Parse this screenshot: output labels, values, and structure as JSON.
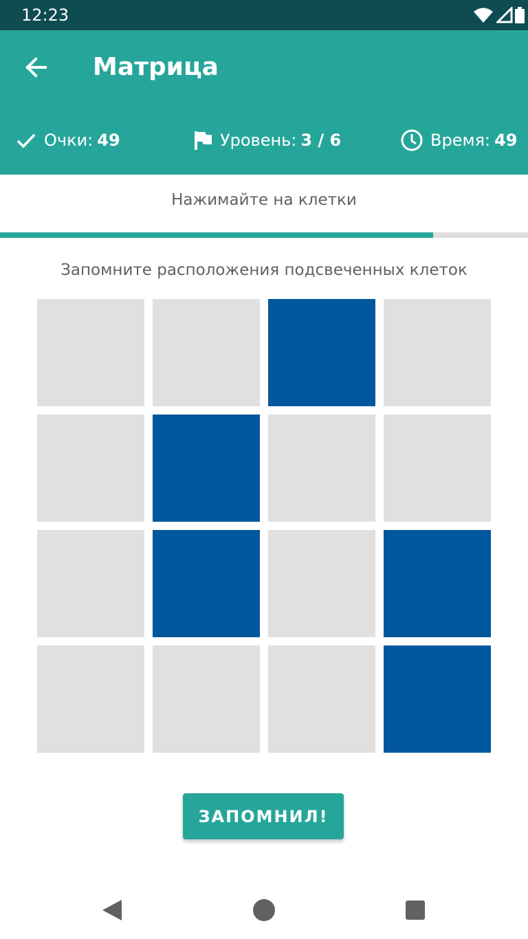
{
  "status_bar": {
    "time": "12:23",
    "icons": [
      "wifi-icon",
      "signal-icon",
      "battery-icon"
    ]
  },
  "app_bar": {
    "title": "Матрица",
    "back_icon": "arrow-back-icon",
    "color": "#26a69a"
  },
  "stats": {
    "score": {
      "icon": "check-icon",
      "label": "Очки:",
      "value": "49"
    },
    "level": {
      "icon": "flag-icon",
      "label": "Уровень:",
      "value": "3 / 6"
    },
    "time": {
      "icon": "clock-icon",
      "label": "Время:",
      "value": "49"
    }
  },
  "hint": "Нажимайте на клетки",
  "progress": {
    "fraction": 0.82
  },
  "instruction": "Запомните расположения подсвеченных клеток",
  "grid": {
    "rows": 4,
    "cols": 4,
    "active_color": "#01579b",
    "inactive_color": "#e0e0e0",
    "cells": [
      [
        false,
        false,
        true,
        false
      ],
      [
        false,
        true,
        false,
        false
      ],
      [
        false,
        true,
        false,
        true
      ],
      [
        false,
        false,
        false,
        true
      ]
    ]
  },
  "button": {
    "label": "ЗАПОМНИЛ!"
  },
  "nav": [
    "back-triangle-icon",
    "home-circle-icon",
    "recents-square-icon"
  ]
}
